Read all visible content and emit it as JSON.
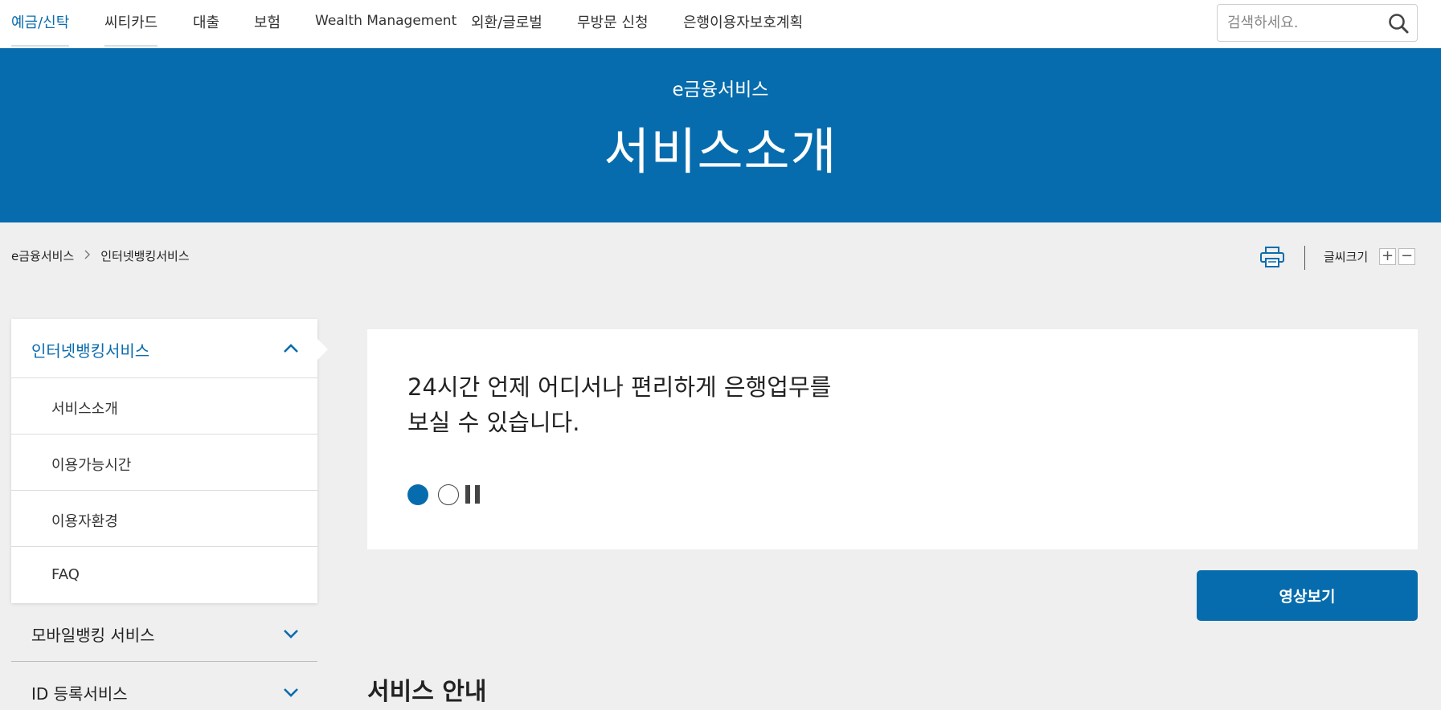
{
  "nav": {
    "items": [
      {
        "label": "예금/신탁",
        "active": true
      },
      {
        "label": "씨티카드",
        "active": false
      },
      {
        "label": "대출",
        "active": false
      },
      {
        "label": "보험",
        "active": false
      },
      {
        "label": "Wealth Management",
        "active": false
      },
      {
        "label": "외환/글로벌",
        "active": false
      },
      {
        "label": "무방문 신청",
        "active": false
      },
      {
        "label": "은행이용자보호계획",
        "active": false
      }
    ],
    "search_placeholder": "검색하세요.",
    "search_icon": "search-icon"
  },
  "hero": {
    "subtitle": "e금융서비스",
    "title": "서비스소개"
  },
  "breadcrumb": {
    "items": [
      "e금융서비스",
      "인터넷뱅킹서비스"
    ]
  },
  "tools": {
    "print_icon": "printer-icon",
    "font_size_label": "글씨크기",
    "plus": "+",
    "minus": "−"
  },
  "sidebar": {
    "open_group": {
      "label": "인터넷뱅킹서비스",
      "items": [
        "서비스소개",
        "이용가능시간",
        "이용자환경",
        "FAQ"
      ]
    },
    "collapsed_groups": [
      "모바일뱅킹 서비스",
      "ID 등록서비스"
    ]
  },
  "slide": {
    "line1": "24시간 언제 어디서나 편리하게 은행업무를",
    "line2": "보실 수 있습니다.",
    "total_slides": 2,
    "current_slide": 1
  },
  "video_button": "영상보기",
  "section_title": "서비스 안내",
  "colors": {
    "primary": "#066cad",
    "background": "#efefef"
  }
}
